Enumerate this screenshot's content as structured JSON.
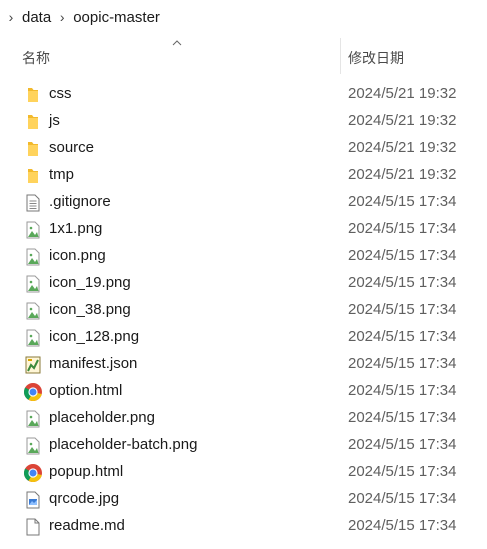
{
  "breadcrumb": {
    "items": [
      "data",
      "oopic-master"
    ]
  },
  "columns": {
    "name": "名称",
    "date_modified": "修改日期",
    "sort": "ascending"
  },
  "colors": {
    "folder": "#f2b92c",
    "image_green": "#5aa85a",
    "chrome_red": "#db4437",
    "chrome_yellow": "#f4c20d",
    "chrome_green": "#0f9d58",
    "chrome_blue": "#4285f4",
    "jpg_blue": "#3a7bd5",
    "date_text": "#5f5f5f"
  },
  "files": [
    {
      "name": "css",
      "date": "2024/5/21 19:32",
      "icon": "folder-icon"
    },
    {
      "name": "js",
      "date": "2024/5/21 19:32",
      "icon": "folder-icon"
    },
    {
      "name": "source",
      "date": "2024/5/21 19:32",
      "icon": "folder-icon"
    },
    {
      "name": "tmp",
      "date": "2024/5/21 19:32",
      "icon": "folder-icon"
    },
    {
      "name": ".gitignore",
      "date": "2024/5/15 17:34",
      "icon": "text-file-icon"
    },
    {
      "name": "1x1.png",
      "date": "2024/5/15 17:34",
      "icon": "image-file-icon"
    },
    {
      "name": "icon.png",
      "date": "2024/5/15 17:34",
      "icon": "image-file-icon"
    },
    {
      "name": "icon_19.png",
      "date": "2024/5/15 17:34",
      "icon": "image-file-icon"
    },
    {
      "name": "icon_38.png",
      "date": "2024/5/15 17:34",
      "icon": "image-file-icon"
    },
    {
      "name": "icon_128.png",
      "date": "2024/5/15 17:34",
      "icon": "image-file-icon"
    },
    {
      "name": "manifest.json",
      "date": "2024/5/15 17:34",
      "icon": "json-file-icon"
    },
    {
      "name": "option.html",
      "date": "2024/5/15 17:34",
      "icon": "chrome-icon"
    },
    {
      "name": "placeholder.png",
      "date": "2024/5/15 17:34",
      "icon": "image-file-icon"
    },
    {
      "name": "placeholder-batch.png",
      "date": "2024/5/15 17:34",
      "icon": "image-file-icon"
    },
    {
      "name": "popup.html",
      "date": "2024/5/15 17:34",
      "icon": "chrome-icon"
    },
    {
      "name": "qrcode.jpg",
      "date": "2024/5/15 17:34",
      "icon": "jpg-file-icon"
    },
    {
      "name": "readme.md",
      "date": "2024/5/15 17:34",
      "icon": "blank-file-icon"
    }
  ]
}
